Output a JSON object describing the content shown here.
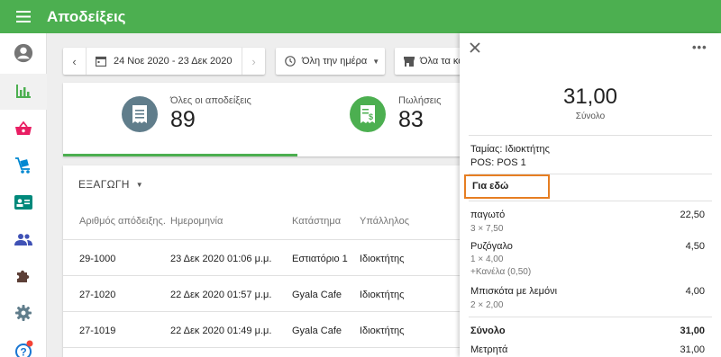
{
  "app": {
    "title": "Αποδείξεις",
    "accent": "#4caf50",
    "menu_icon": "hamburger-menu-icon"
  },
  "sidebar": {
    "items": [
      {
        "name": "account-icon",
        "color": "#757575"
      },
      {
        "name": "bar-chart-icon",
        "color": "#4caf50",
        "active": true
      },
      {
        "name": "shopping-basket-icon",
        "color": "#e91e63"
      },
      {
        "name": "cart-icon",
        "color": "#0288d1"
      },
      {
        "name": "id-card-icon",
        "color": "#00897b"
      },
      {
        "name": "people-icon",
        "color": "#3f51b5"
      },
      {
        "name": "puzzle-icon",
        "color": "#5d4037"
      },
      {
        "name": "gear-icon",
        "color": "#607d8b"
      },
      {
        "name": "help-icon",
        "color": "#1976d2",
        "badge_color": "#f44336"
      }
    ]
  },
  "filters": {
    "date_range": "24 Νοε 2020 - 23 Δεκ 2020",
    "time": "Όλη την ημέρα",
    "stores": "Όλα τα κα"
  },
  "summary": {
    "all": {
      "label": "Όλες οι αποδείξεις",
      "value": "89",
      "color": "#607d8b"
    },
    "sales": {
      "label": "Πωλήσεις",
      "value": "83",
      "color": "#4caf50"
    }
  },
  "table": {
    "export_label": "ΕΞΑΓΩΓΗ",
    "columns": [
      "Αριθμός απόδειξης.",
      "Ημερομηνία",
      "Κατάστημα",
      "Υπάλληλος"
    ],
    "rows": [
      [
        "29-1000",
        "23 Δεκ 2020 01:06 μ.μ.",
        "Εστιατόριο 1",
        "Ιδιοκτήτης"
      ],
      [
        "27-1020",
        "22 Δεκ 2020 01:57 μ.μ.",
        "Gyala Cafe",
        "Ιδιοκτήτης"
      ],
      [
        "27-1019",
        "22 Δεκ 2020 01:49 μ.μ.",
        "Gyala Cafe",
        "Ιδιοκτήτης"
      ]
    ]
  },
  "receipt": {
    "total_amount": "31,00",
    "total_caption": "Σύνολο",
    "cashier": "Ταμίας: Ιδιοκτήτης",
    "pos": "POS: POS 1",
    "dining_option": "Για εδώ",
    "dining_highlight_color": "#e67e22",
    "items": [
      {
        "name": "παγωτό",
        "price": "22,50",
        "details": [
          "3 × 7,50"
        ]
      },
      {
        "name": "Ρυζόγαλο",
        "price": "4,50",
        "details": [
          "1 × 4,00",
          "+Κανέλα (0,50)"
        ]
      },
      {
        "name": "Μπισκότα με λεμόνι",
        "price": "4,00",
        "details": [
          "2 × 2,00"
        ]
      }
    ],
    "total_label": "Σύνολο",
    "total_value": "31,00",
    "payment_label": "Μετρητά",
    "payment_value": "31,00"
  }
}
